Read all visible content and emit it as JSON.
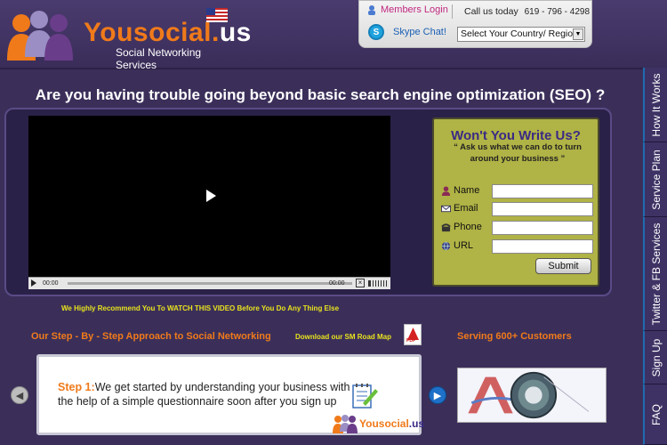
{
  "header": {
    "brand_main": "Yousocial",
    "brand_dot": ".",
    "brand_suffix": "us",
    "tagline": "Social Networking Services",
    "members_login": "Members Login",
    "call_label": "Call us today",
    "phone": "619 - 796 - 4298",
    "skype_label": "Skype Chat!",
    "country_select": "Select Your Country/ Region"
  },
  "headline": "Are you having trouble going beyond basic search engine optimization (SEO) ?",
  "video": {
    "time_current": "00:00",
    "time_total": "00:00"
  },
  "form": {
    "title": "Won't You Write Us?",
    "subtitle": "“ Ask us what we can do to turn around your business ”",
    "fields": [
      {
        "label": "Name",
        "icon": "person-icon"
      },
      {
        "label": "Email",
        "icon": "envelope-icon"
      },
      {
        "label": "Phone",
        "icon": "phone-icon"
      },
      {
        "label": "URL",
        "icon": "globe-icon"
      }
    ],
    "submit_label": "Submit"
  },
  "recommend_text": "We Highly Recommend You To WATCH THIS VIDEO Before You Do Any Thing Else",
  "steps": {
    "section_title": "Our Step - By - Step Approach to Social Networking",
    "roadmap_link": "Download our SM Road Map",
    "pdf_label": "PDF",
    "current_step_label": "Step 1:",
    "current_step_text": "We get started by understanding your business with the help of a simple questionnaire soon after you sign up",
    "mini_brand": "Yousocial",
    "mini_suffix": ".us"
  },
  "serving_text": "Serving 600+ Customers",
  "sidetabs": [
    "How It Works",
    "Service Plan",
    "Twitter & FB Services",
    "Sign Up",
    "FAQ"
  ],
  "colors": {
    "background": "#3b2f5a",
    "accent_orange": "#f07a1a",
    "accent_yellow": "#e8e21d",
    "form_bg": "#b0b345"
  }
}
